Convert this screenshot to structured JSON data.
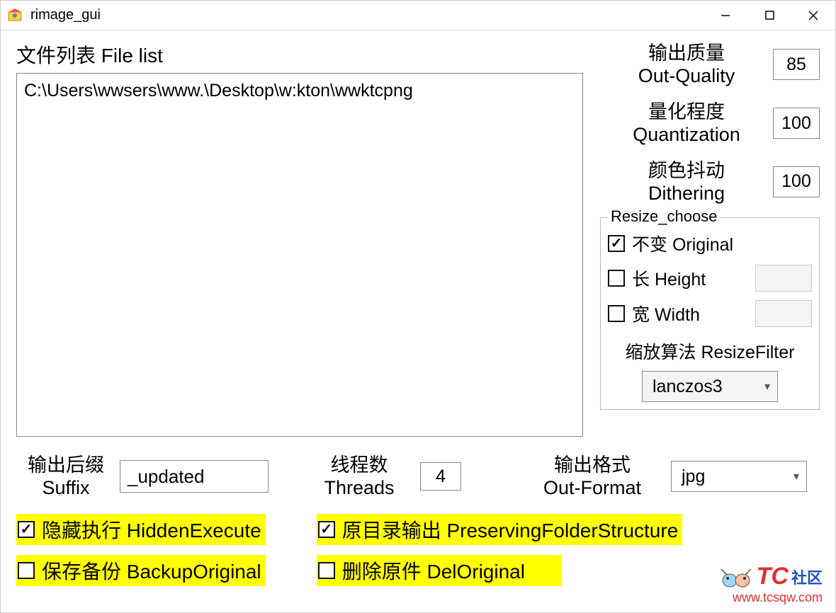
{
  "titlebar": {
    "title": "rimage_gui"
  },
  "filelist": {
    "label": "文件列表 File list",
    "content": "C:\\Users\\wwsers\\www.\\Desktop\\w:kton\\wwktcpng"
  },
  "params": {
    "quality": {
      "label_cn": "输出质量",
      "label_en": "Out-Quality",
      "value": "85"
    },
    "quantization": {
      "label_cn": "量化程度",
      "label_en": "Quantization",
      "value": "100"
    },
    "dithering": {
      "label_cn": "颜色抖动",
      "label_en": "Dithering",
      "value": "100"
    }
  },
  "resize": {
    "legend": "Resize_choose",
    "original": {
      "label": "不变 Original",
      "checked": true
    },
    "height": {
      "label": "长 Height",
      "checked": false,
      "value": ""
    },
    "width": {
      "label": "宽 Width",
      "checked": false,
      "value": ""
    },
    "filter_label": "缩放算法 ResizeFilter",
    "filter_value": "lanczos3"
  },
  "suffix": {
    "label_cn": "输出后缀",
    "label_en": "Suffix",
    "value": "_updated"
  },
  "threads": {
    "label_cn": "线程数",
    "label_en": "Threads",
    "value": "4"
  },
  "format": {
    "label_cn": "输出格式",
    "label_en": "Out-Format",
    "value": "jpg"
  },
  "checks": {
    "hidden": {
      "label": "隐藏执行 HiddenExecute",
      "checked": true
    },
    "backup": {
      "label": "保存备份 BackupOriginal",
      "checked": false
    },
    "preserve": {
      "label": "原目录输出 PreservingFolderStructure",
      "checked": true
    },
    "delete": {
      "label": "删除原件 DelOriginal",
      "checked": false
    }
  },
  "watermark": {
    "brand": "TC",
    "brand_suffix": "社区",
    "url": "www.tcsqw.com"
  }
}
